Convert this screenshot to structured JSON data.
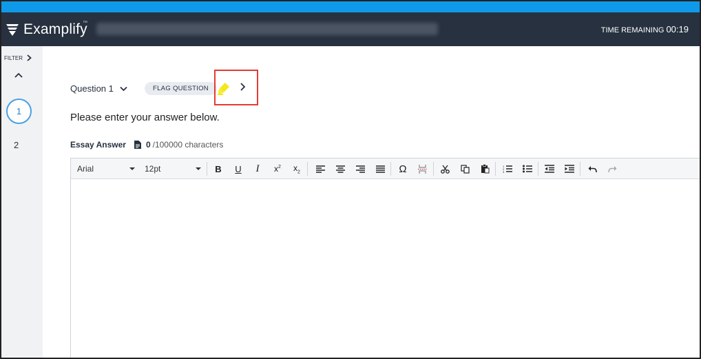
{
  "app": {
    "name": "Examplify",
    "trademark": "™"
  },
  "header": {
    "time_label": "TIME REMAINING",
    "time_value": "00:19"
  },
  "sidebar": {
    "filter_label": "FILTER",
    "questions": [
      "1",
      "2"
    ],
    "current": "1"
  },
  "question": {
    "title": "Question 1",
    "flag_label": "FLAG QUESTION",
    "prompt": "Please enter your answer below."
  },
  "essay": {
    "label": "Essay Answer",
    "count": "0",
    "limit": "/100000 characters"
  },
  "toolbar": {
    "font": "Arial",
    "size": "12pt",
    "buttons": [
      "bold",
      "underline",
      "italic",
      "superscript",
      "subscript",
      "align-left",
      "align-center",
      "align-right",
      "justify",
      "special-character",
      "page-break",
      "cut",
      "copy",
      "paste",
      "numbered-list",
      "bulleted-list",
      "outdent",
      "indent",
      "undo",
      "redo"
    ]
  },
  "colors": {
    "accent": "#0f9ae9",
    "header": "#27313f",
    "highlight_box": "#e53935",
    "highlighter": "#f4e81a"
  }
}
